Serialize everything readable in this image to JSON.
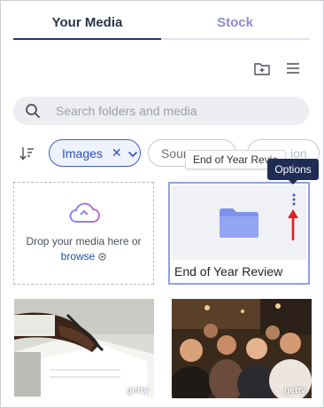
{
  "tabs": [
    {
      "label": "Your Media",
      "active": true
    },
    {
      "label": "Stock",
      "active": false
    }
  ],
  "toolbar": {
    "new_folder_icon": "folder-plus-icon",
    "menu_icon": "hamburger-menu-icon"
  },
  "search": {
    "placeholder": "Search folders and media",
    "value": ""
  },
  "filters": {
    "sort_icon": "sort-icon",
    "chips": [
      {
        "label": "Images",
        "selected": true
      },
      {
        "label": "Sour",
        "selected": false
      },
      {
        "label": "ion",
        "selected": false
      }
    ]
  },
  "tooltips": {
    "folder_name": "End of Year Revie",
    "options": "Options"
  },
  "dropzone": {
    "text": "Drop your media here or",
    "browse_label": "browse"
  },
  "folder": {
    "name": "End of Year Review"
  },
  "media": [
    {
      "watermark": "getty",
      "subject": "hand-signing-document"
    },
    {
      "watermark": "getty",
      "subject": "crowd-at-party"
    }
  ],
  "colors": {
    "accent": "#3b5ccc",
    "tab_active": "#1f3a6e",
    "tab_inactive": "#8b8fd0",
    "folder_icon": "#8b9df0",
    "tooltip_dark": "#1f2c54",
    "arrow": "#e02020"
  }
}
